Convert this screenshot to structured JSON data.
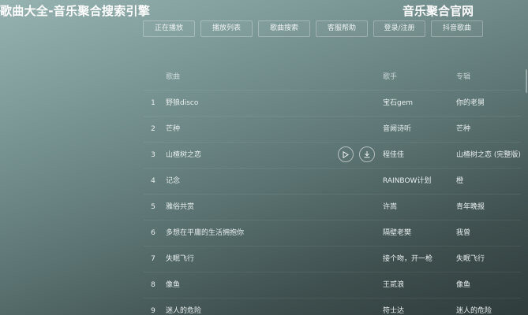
{
  "header": {
    "site_title": "歌曲大全-音乐聚合搜索引擎",
    "official_site": "音乐聚合官网"
  },
  "nav": [
    {
      "label": "正在播放"
    },
    {
      "label": "播放列表"
    },
    {
      "label": "歌曲搜索"
    },
    {
      "label": "客服帮助"
    },
    {
      "label": "登录/注册"
    },
    {
      "label": "抖音歌曲"
    }
  ],
  "table": {
    "columns": {
      "title": "歌曲",
      "artist": "歌手",
      "album": "专辑"
    },
    "rows": [
      {
        "index": "1",
        "title": "野狼disco",
        "artist": "宝石gem",
        "album": "你的老舅"
      },
      {
        "index": "2",
        "title": "芒种",
        "artist": "音阙诗听",
        "album": "芒种"
      },
      {
        "index": "3",
        "title": "山楂树之恋",
        "artist": "程佳佳",
        "album": "山楂树之恋 (完整版)"
      },
      {
        "index": "4",
        "title": "记念",
        "artist": "RAINBOW计划",
        "album": "橙"
      },
      {
        "index": "5",
        "title": "雅俗共赏",
        "artist": "许嵩",
        "album": "青年晚报"
      },
      {
        "index": "6",
        "title": "多想在平庸的生活拥抱你",
        "artist": "隔壁老樊",
        "album": "我曾"
      },
      {
        "index": "7",
        "title": "失眠飞行",
        "artist": "接个吻，开一枪",
        "album": "失眠飞行"
      },
      {
        "index": "8",
        "title": "像鱼",
        "artist": "王贰浪",
        "album": "像鱼"
      },
      {
        "index": "9",
        "title": "迷人的危险",
        "artist": "符士达",
        "album": "迷人的危险"
      }
    ]
  },
  "icons": {
    "play": "play-icon",
    "download": "download-icon"
  }
}
